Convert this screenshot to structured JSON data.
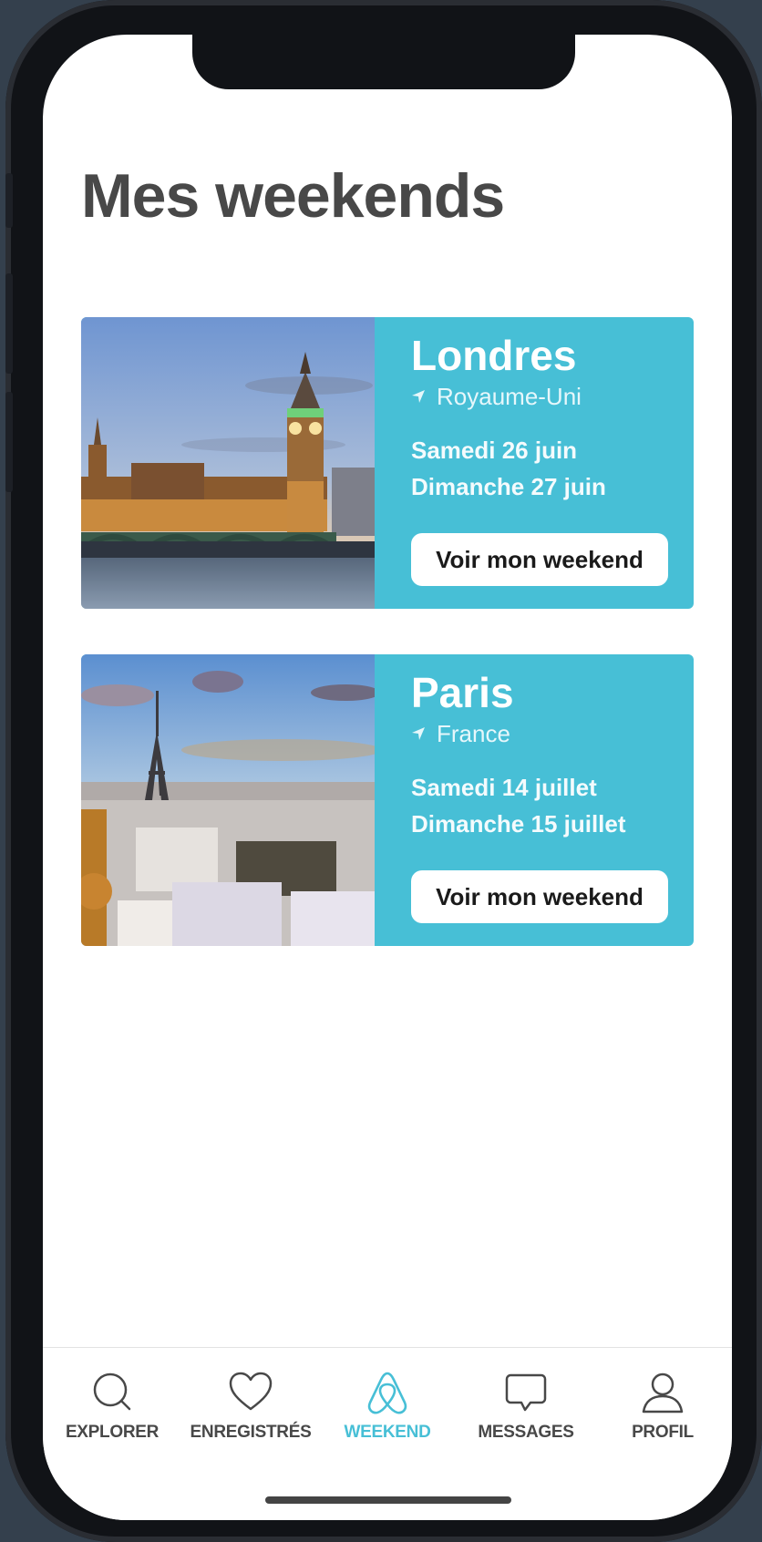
{
  "page": {
    "title": "Mes weekends"
  },
  "colors": {
    "accent": "#47bfd6",
    "title": "#484848",
    "tab_inactive": "#484848"
  },
  "weekends": [
    {
      "city": "Londres",
      "country": "Royaume-Uni",
      "date_start": "Samedi 26 juin",
      "date_end": "Dimanche 27 juin",
      "button_label": "Voir mon weekend",
      "location_icon": "navigation-arrow-icon",
      "image": "london-big-ben-photo"
    },
    {
      "city": "Paris",
      "country": "France",
      "date_start": "Samedi 14 juillet",
      "date_end": "Dimanche 15 juillet",
      "button_label": "Voir mon weekend",
      "location_icon": "navigation-arrow-icon",
      "image": "paris-eiffel-tower-photo"
    }
  ],
  "tabbar": {
    "items": [
      {
        "label": "EXPLORER",
        "icon": "search-icon",
        "active": false
      },
      {
        "label": "ENREGISTRÉS",
        "icon": "heart-icon",
        "active": false
      },
      {
        "label": "WEEKEND",
        "icon": "airbnb-logo-icon",
        "active": true
      },
      {
        "label": "MESSAGES",
        "icon": "chat-bubble-icon",
        "active": false
      },
      {
        "label": "PROFIL",
        "icon": "user-icon",
        "active": false
      }
    ]
  }
}
